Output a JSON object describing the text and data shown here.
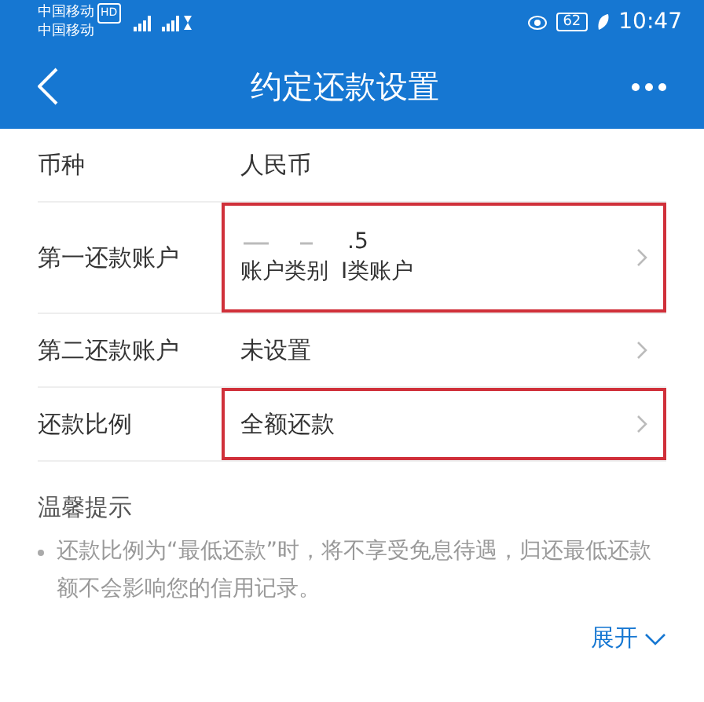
{
  "status_bar": {
    "carriers": [
      "中国移动",
      "中国移动"
    ],
    "hd_badge": "HD",
    "battery": "62",
    "time": "10:47"
  },
  "nav": {
    "title": "约定还款设置"
  },
  "rows": [
    {
      "kind": "plain",
      "label": "币种",
      "value": "人民币",
      "chevron": false,
      "highlighted": false
    },
    {
      "kind": "account",
      "label": "第一还款账户",
      "value": ".5",
      "detail_label": "账户类别",
      "detail_value": "I类账户",
      "chevron": true,
      "highlighted": true
    },
    {
      "kind": "plain",
      "label": "第二还款账户",
      "value": "未设置",
      "chevron": true,
      "highlighted": false
    },
    {
      "kind": "plain",
      "label": "还款比例",
      "value": "全额还款",
      "chevron": true,
      "highlighted": true
    }
  ],
  "tips": {
    "title": "温馨提示",
    "items": [
      "还款比例为“最低还款”时，将不享受免息待遇，归还最低还款额不会影响您的信用记录。"
    ],
    "expand": "展开"
  }
}
